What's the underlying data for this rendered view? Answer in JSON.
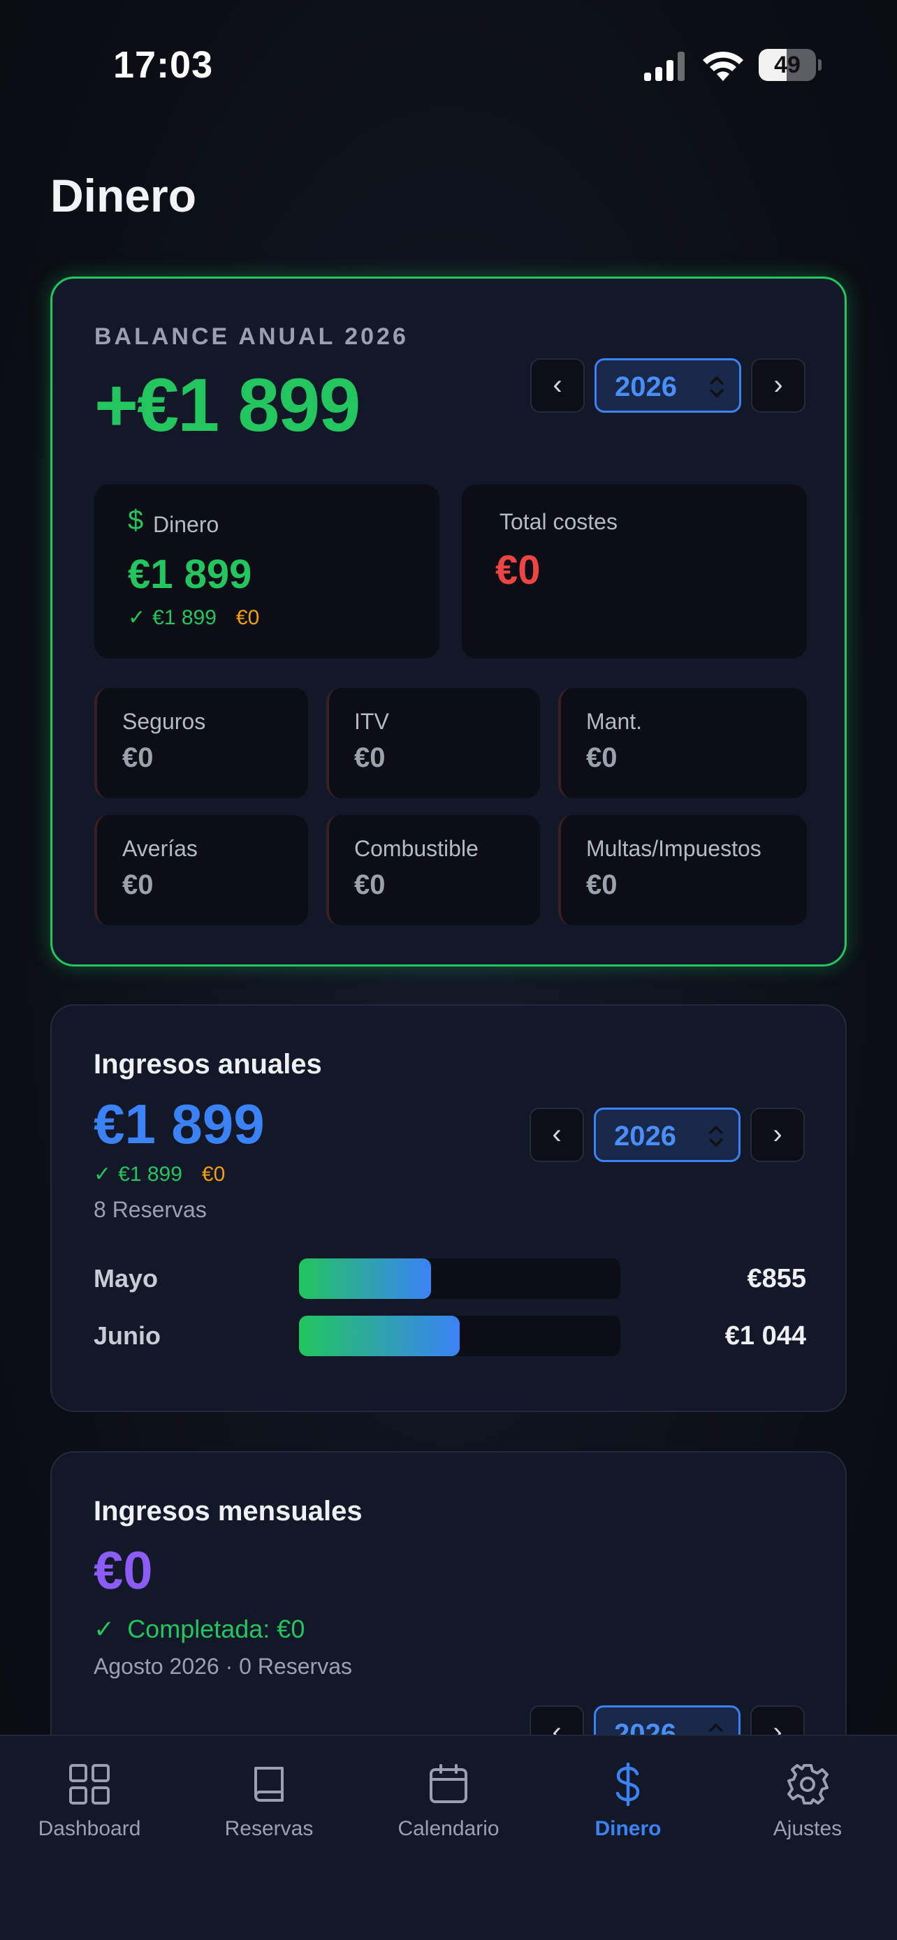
{
  "status_bar": {
    "time": "17:03",
    "battery": "49",
    "battery_fraction": 0.49
  },
  "page": {
    "title": "Dinero"
  },
  "balance": {
    "overline": "BALANCE ANUAL 2026",
    "total": "+€1 899",
    "year": "2026",
    "money": {
      "label": "Dinero",
      "value": "€1 899",
      "done": "€1 899",
      "pending": "€0"
    },
    "costs": {
      "label": "Total costes",
      "value": "€0"
    },
    "categories": [
      {
        "label": "Seguros",
        "value": "€0"
      },
      {
        "label": "ITV",
        "value": "€0"
      },
      {
        "label": "Mant.",
        "value": "€0"
      },
      {
        "label": "Averías",
        "value": "€0"
      },
      {
        "label": "Combustible",
        "value": "€0"
      },
      {
        "label": "Multas/Impuestos",
        "value": "€0"
      }
    ]
  },
  "annual": {
    "title": "Ingresos anuales",
    "total": "€1 899",
    "done": "€1 899",
    "pending": "€0",
    "bookings": "8 Reservas",
    "year": "2026",
    "months": [
      {
        "label": "Mayo",
        "value": "€855",
        "amount": 855,
        "fill_fraction": 0.41
      },
      {
        "label": "Junio",
        "value": "€1 044",
        "amount": 1044,
        "fill_fraction": 0.5
      }
    ]
  },
  "monthly": {
    "title": "Ingresos mensuales",
    "total": "€0",
    "status": "Completada: €0",
    "period": "Agosto 2026 · 0 Reservas",
    "year": "2026"
  },
  "nav": {
    "prev": "‹",
    "next": "›"
  },
  "tabs": [
    {
      "label": "Dashboard",
      "icon": "grid-icon"
    },
    {
      "label": "Reservas",
      "icon": "book-icon"
    },
    {
      "label": "Calendario",
      "icon": "calendar-icon"
    },
    {
      "label": "Dinero",
      "icon": "dollar-icon",
      "active": true
    },
    {
      "label": "Ajustes",
      "icon": "gear-icon"
    }
  ],
  "colors": {
    "accent": "#3b82f6",
    "income": "#22c55e",
    "cost": "#ef4444",
    "pending": "#f59e0b",
    "monthly": "#8b5cf6"
  }
}
